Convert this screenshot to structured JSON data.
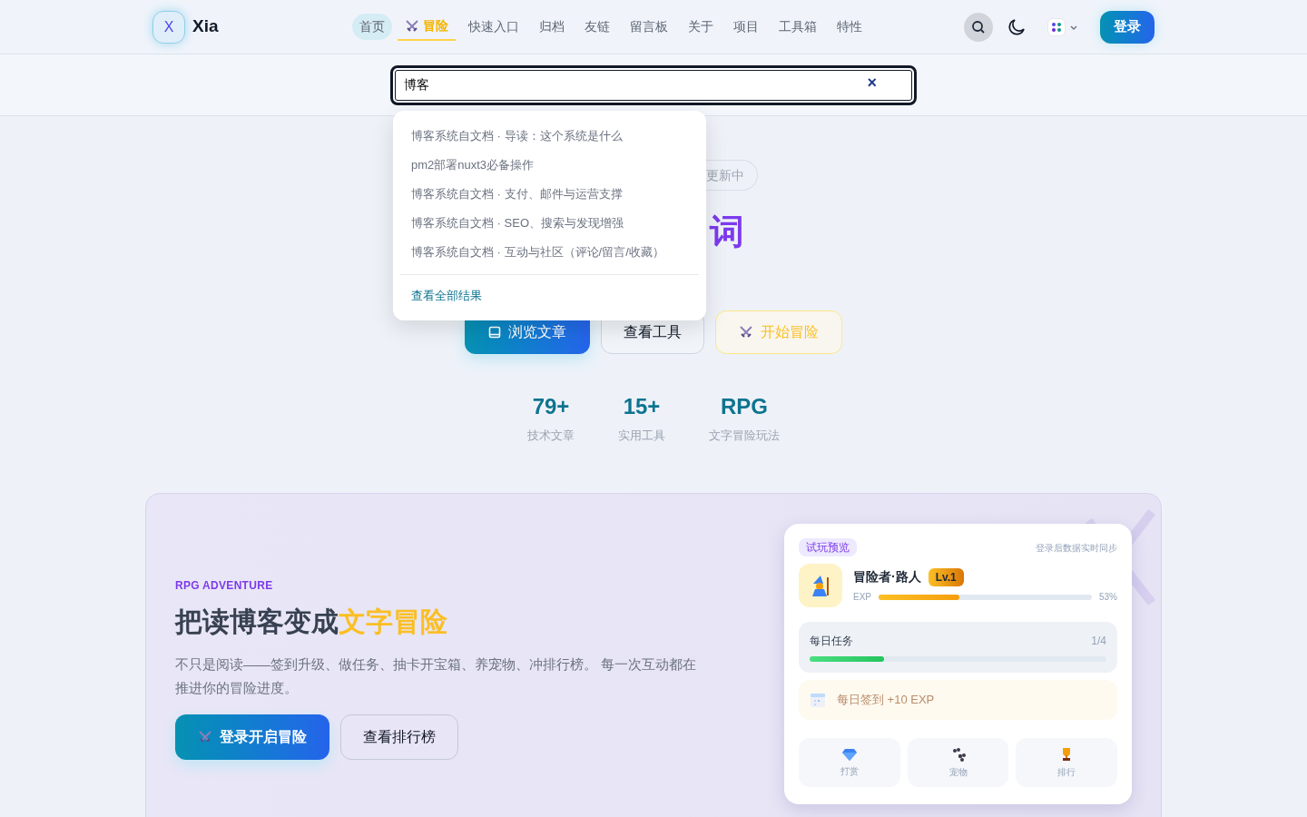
{
  "header": {
    "logo_letter": "X",
    "brand": "Xia",
    "nav": [
      {
        "label": "首页",
        "kind": "plain",
        "selected": true
      },
      {
        "label": "冒险",
        "kind": "adventure",
        "selected": false
      },
      {
        "label": "快速入口",
        "kind": "plain",
        "selected": false
      },
      {
        "label": "归档",
        "kind": "plain",
        "selected": false
      },
      {
        "label": "友链",
        "kind": "plain",
        "selected": false
      },
      {
        "label": "留言板",
        "kind": "plain",
        "selected": false
      },
      {
        "label": "关于",
        "kind": "plain",
        "selected": false
      },
      {
        "label": "项目",
        "kind": "plain",
        "selected": false
      },
      {
        "label": "工具箱",
        "kind": "plain",
        "selected": false
      },
      {
        "label": "特性",
        "kind": "plain",
        "selected": false
      }
    ],
    "login": "登录"
  },
  "search": {
    "value": "博客",
    "clear": "×",
    "results": [
      "博客系统自文档 · 导读：这个系统是什么",
      "pm2部署nuxt3必备操作",
      "博客系统自文档 · 支付、邮件与运营支撑",
      "博客系统自文档 · SEO、搜索与发现增强",
      "博客系统自文档 · 互动与社区（评论/留言/收藏）"
    ],
    "view_all": "查看全部结果"
  },
  "hero": {
    "badge_visible": "更新中",
    "title_visible": "词",
    "buttons": [
      {
        "label": "浏览文章",
        "kind": "primary"
      },
      {
        "label": "查看工具",
        "kind": "outline"
      },
      {
        "label": "开始冒险",
        "kind": "adventure"
      }
    ],
    "stats": [
      {
        "value": "79+",
        "label": "技术文章"
      },
      {
        "value": "15+",
        "label": "实用工具"
      },
      {
        "value": "RPG",
        "label": "文字冒险玩法"
      }
    ]
  },
  "rpg": {
    "eyebrow": "RPG ADVENTURE",
    "title": "把读博客变成**文字冒险**",
    "text": "不只是阅读——签到升级、做任务、抽卡开宝箱、养宠物、冲排行榜。 每一次互动都在推进你的冒险进度。",
    "buttons": [
      {
        "label": "登录开启冒险",
        "kind": "primary"
      },
      {
        "label": "查看排行榜",
        "kind": "outline"
      }
    ],
    "card": {
      "tag": "试玩预览",
      "sync": "登录后数据实时同步",
      "name": "冒险者·路人",
      "level_badge": "Lv.1",
      "exp_label": "EXP",
      "exp": {
        "level": 0.38
      },
      "exp_reading": "53%",
      "task": {
        "title": "每日任务",
        "count": "1/4",
        "level": 0.25
      },
      "checkin": "每日签到 +10 EXP",
      "tiles": [
        {
          "label": "打赏",
          "kind": "gem"
        },
        {
          "label": "宠物",
          "kind": "paw"
        },
        {
          "label": "排行",
          "kind": "trophy"
        }
      ]
    }
  }
}
